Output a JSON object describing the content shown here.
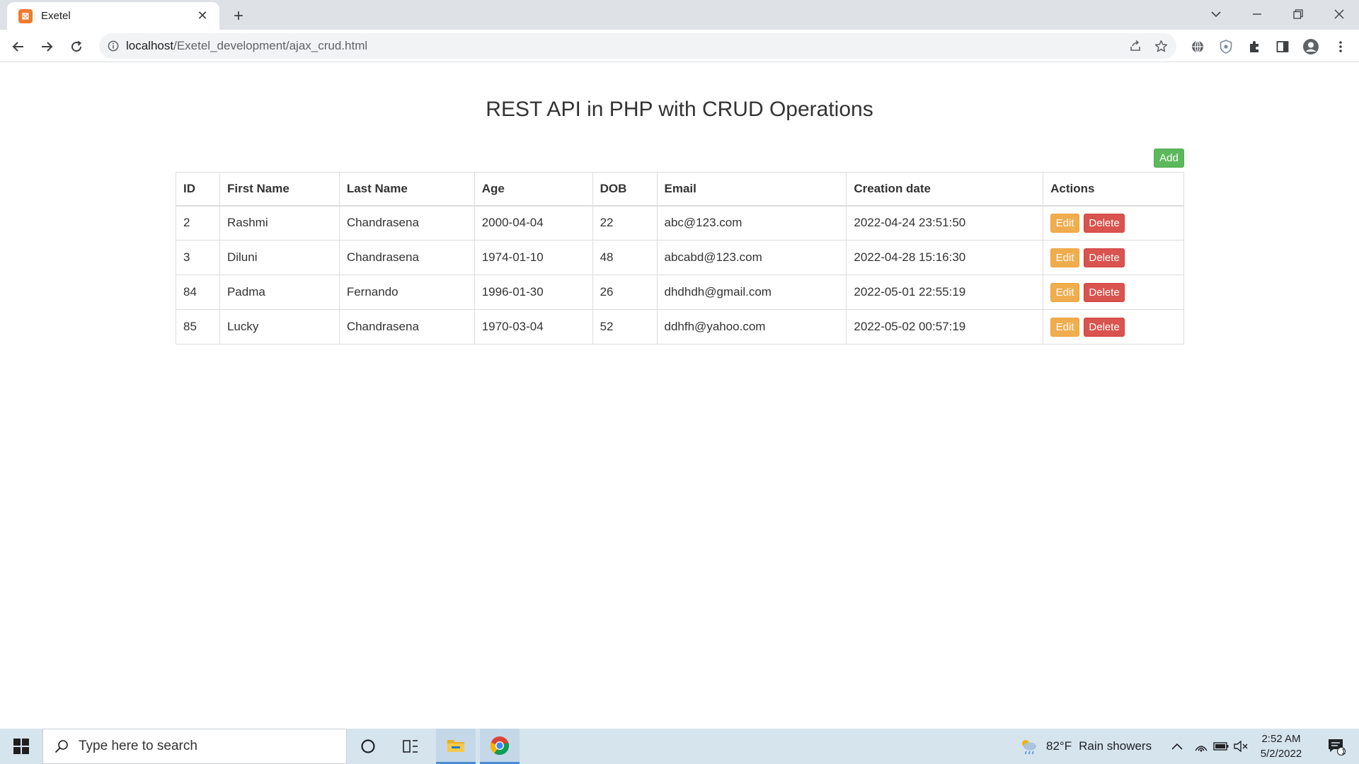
{
  "browser": {
    "tab_title": "Exetel",
    "tab_close": "✕",
    "new_tab": "+",
    "url_host": "localhost",
    "url_path": "/Exetel_development/ajax_crud.html"
  },
  "page": {
    "title": "REST API in PHP with CRUD Operations",
    "add_label": "Add"
  },
  "table": {
    "headers": [
      "ID",
      "First Name",
      "Last Name",
      "Age",
      "DOB",
      "Email",
      "Creation date",
      "Actions"
    ],
    "rows": [
      {
        "id": "2",
        "first": "Rashmi",
        "last": "Chandrasena",
        "age": "2000-04-04",
        "dob": "22",
        "email": "abc@123.com",
        "created": "2022-04-24 23:51:50"
      },
      {
        "id": "3",
        "first": "Diluni",
        "last": "Chandrasena",
        "age": "1974-01-10",
        "dob": "48",
        "email": "abcabd@123.com",
        "created": "2022-04-28 15:16:30"
      },
      {
        "id": "84",
        "first": "Padma",
        "last": "Fernando",
        "age": "1996-01-30",
        "dob": "26",
        "email": "dhdhdh@gmail.com",
        "created": "2022-05-01 22:55:19"
      },
      {
        "id": "85",
        "first": "Lucky",
        "last": "Chandrasena",
        "age": "1970-03-04",
        "dob": "52",
        "email": "ddhfh@yahoo.com",
        "created": "2022-05-02 00:57:19"
      }
    ],
    "edit_label": "Edit",
    "delete_label": "Delete"
  },
  "taskbar": {
    "search_placeholder": "Type here to search",
    "weather_temp": "82°F",
    "weather_text": "Rain showers",
    "time": "2:52 AM",
    "date": "5/2/2022",
    "notification_count": "1"
  },
  "colors": {
    "add": "#5cb85c",
    "edit": "#f0ad4e",
    "delete": "#d9534f"
  }
}
